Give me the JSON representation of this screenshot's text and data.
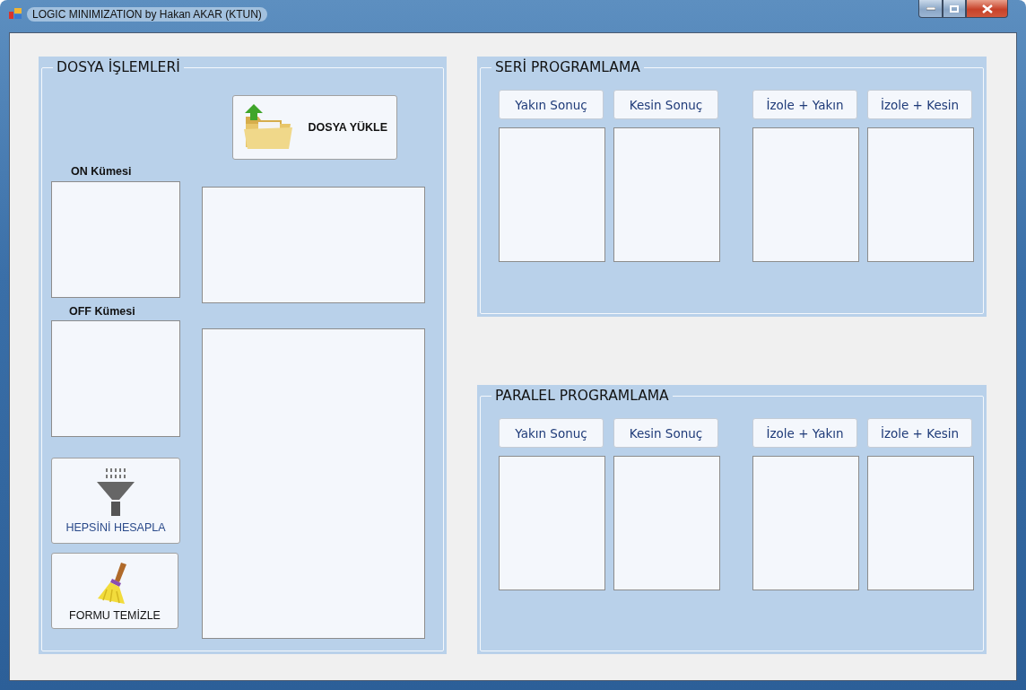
{
  "window": {
    "title": "LOGIC MINIMIZATION  by Hakan AKAR (KTUN)"
  },
  "file_panel": {
    "title": "DOSYA İŞLEMLERİ",
    "load_button": "DOSYA YÜKLE",
    "on_label": "ON Kümesi",
    "off_label": "OFF Kümesi",
    "calculate_button": "HEPSİNİ HESAPLA",
    "clear_button": "FORMU TEMİZLE"
  },
  "programming_panels": [
    {
      "title": "SERİ PROGRAMLAMA",
      "buttons": [
        "Yakın Sonuç",
        "Kesin Sonuç",
        "İzole + Yakın",
        "İzole + Kesin"
      ]
    },
    {
      "title": "PARALEL PROGRAMLAMA",
      "buttons": [
        "Yakın Sonuç",
        "Kesin Sonuç",
        "İzole + Yakın",
        "İzole + Kesin"
      ]
    }
  ]
}
